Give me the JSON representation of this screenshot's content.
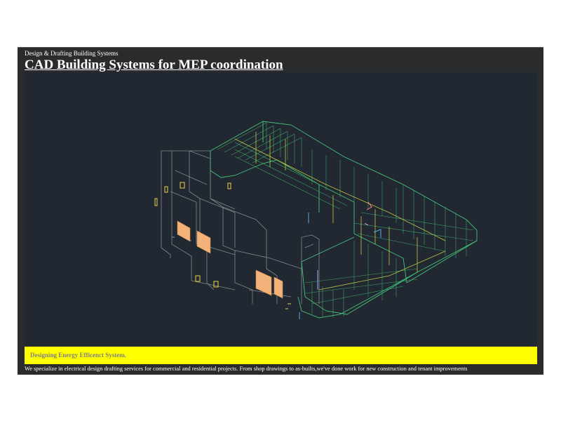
{
  "header": {
    "subtitle": "Design & Drafting Building Systems",
    "title": "CAD Building Systems for MEP coordination"
  },
  "viewport": {
    "image_description_icon": "isometric-cad-building-model-icon",
    "background_color": "#222831"
  },
  "banner": {
    "text": "Designing Energy Efficenct System.",
    "background_color": "#ffff00",
    "text_color": "#808080"
  },
  "description": {
    "text": "We specialize in electrical design drafting services for commercial and residential projects. From shop drawings to as-builts,we've done work for new construction and tenant improvements"
  }
}
